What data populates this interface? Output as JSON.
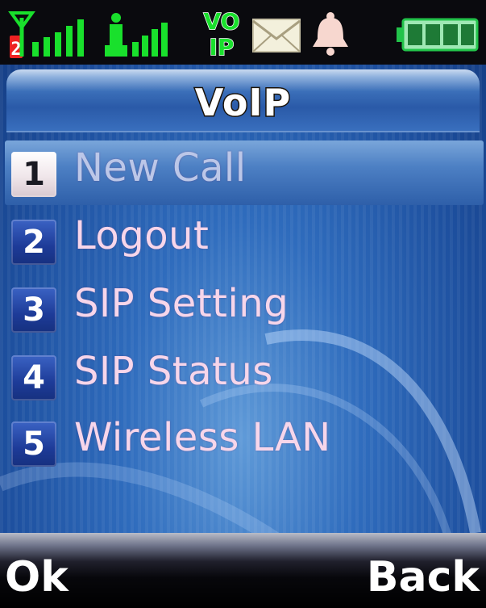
{
  "status_bar": {
    "icons": [
      "signal-strength-icon",
      "wifi-signal-icon",
      "voip-icon",
      "message-envelope-icon",
      "alarm-bell-icon",
      "battery-icon"
    ],
    "network_signal_bars": 5,
    "wifi_signal_bars": 4,
    "line_number": "2",
    "voip_badge": {
      "line1": "VO",
      "line2": "IP"
    },
    "battery_segments": 4,
    "colors": {
      "signal": "#19e02c",
      "envelope": "#f3f0dc",
      "bell": "#f7d7cf",
      "battery": "#22c34a"
    }
  },
  "title": "VoIP",
  "menu": {
    "selected_index": 0,
    "items": [
      {
        "number": "1",
        "label": "New Call"
      },
      {
        "number": "2",
        "label": "Logout"
      },
      {
        "number": "3",
        "label": "SIP Setting"
      },
      {
        "number": "4",
        "label": "SIP Status"
      },
      {
        "number": "5",
        "label": "Wireless LAN"
      }
    ]
  },
  "softkeys": {
    "left": "Ok",
    "right": "Back"
  },
  "colors": {
    "background": "#2f6cbd",
    "menu_text": "#f7d6ea",
    "selected_text": "#bcc7e8",
    "number_badge": "#1d3b98",
    "selected_badge": "#ffffff"
  }
}
